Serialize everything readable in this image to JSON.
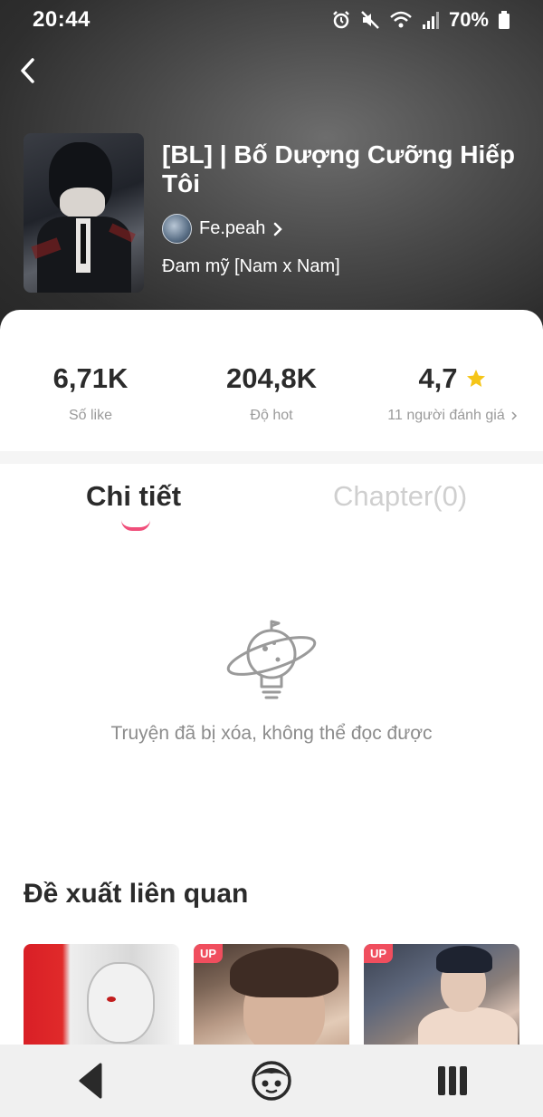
{
  "status_bar": {
    "time": "20:44",
    "battery": "70%",
    "icons": [
      "alarm-icon",
      "mute-icon",
      "wifi-icon",
      "signal-icon",
      "battery-icon"
    ]
  },
  "story": {
    "title": "[BL] | Bố Dượng Cưỡng Hiếp Tôi",
    "author": "Fe.peah",
    "genre": "Đam mỹ [Nam x Nam]"
  },
  "stats": {
    "likes": {
      "value": "6,71K",
      "label": "Số like"
    },
    "hot": {
      "value": "204,8K",
      "label": "Độ hot"
    },
    "rating": {
      "value": "4,7",
      "label": "11 người đánh giá"
    }
  },
  "tabs": {
    "details": "Chi tiết",
    "chapters": "Chapter(0)"
  },
  "empty_state": {
    "message": "Truyện đã bị xóa, không thể đọc được"
  },
  "related": {
    "title": "Đề xuất liên quan",
    "items": [
      {
        "badge": ""
      },
      {
        "badge": "UP"
      },
      {
        "badge": "UP"
      }
    ]
  },
  "colors": {
    "accent": "#f04e7a",
    "star": "#f5c518",
    "badge": "#f04e5e"
  }
}
